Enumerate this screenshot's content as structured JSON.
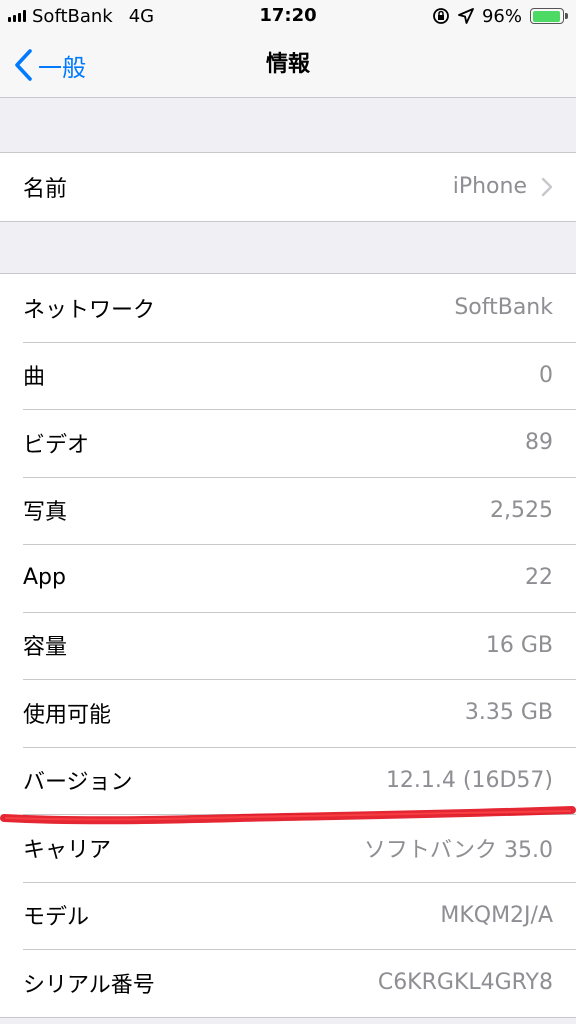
{
  "status_bar": {
    "carrier": "SoftBank",
    "network": "4G",
    "time": "17:20",
    "battery": "96%",
    "battery_level": 0.96
  },
  "nav": {
    "back_label": "一般",
    "title": "情報"
  },
  "name_row": {
    "label": "名前",
    "value": "iPhone"
  },
  "info_rows": [
    {
      "label": "ネットワーク",
      "value": "SoftBank"
    },
    {
      "label": "曲",
      "value": "0"
    },
    {
      "label": "ビデオ",
      "value": "89"
    },
    {
      "label": "写真",
      "value": "2,525"
    },
    {
      "label": "App",
      "value": "22"
    },
    {
      "label": "容量",
      "value": "16 GB"
    },
    {
      "label": "使用可能",
      "value": "3.35 GB"
    },
    {
      "label": "バージョン",
      "value": "12.1.4 (16D57)"
    },
    {
      "label": "キャリア",
      "value": "ソフトバンク 35.0"
    },
    {
      "label": "モデル",
      "value": "MKQM2J/A"
    },
    {
      "label": "シリアル番号",
      "value": "C6KRGKL4GRY8"
    }
  ],
  "colors": {
    "accent": "#007aff",
    "battery": "#4cd964",
    "annotation": "#e0000f"
  }
}
